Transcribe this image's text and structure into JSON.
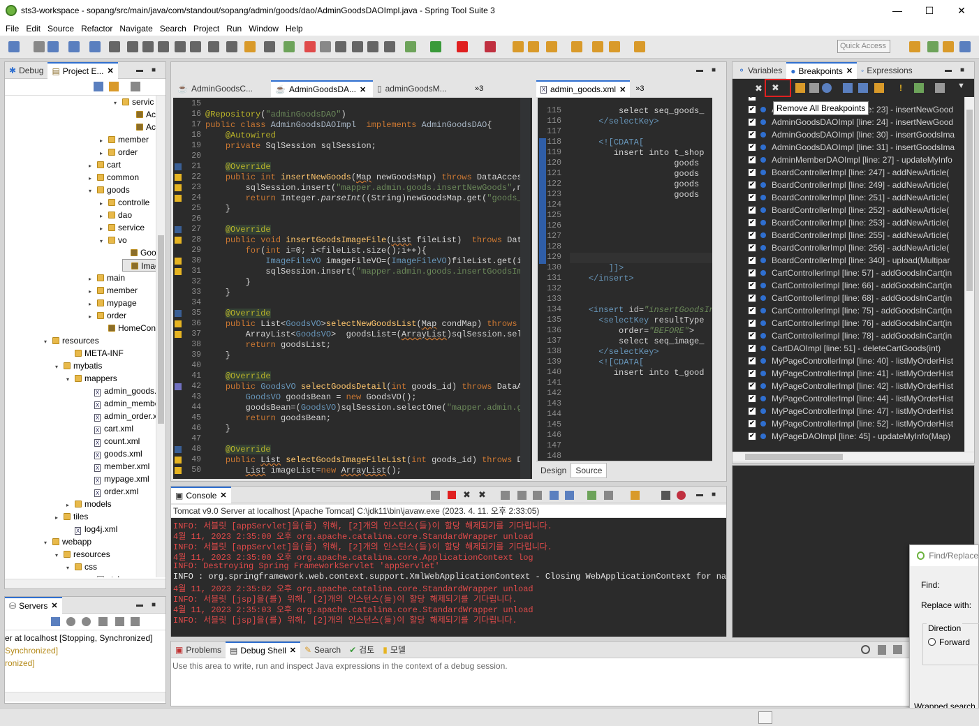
{
  "window": {
    "title": "sts3-workspace - sopang/src/main/java/com/standout/sopang/admin/goods/dao/AdminGoodsDAOImpl.java - Spring Tool Suite 3",
    "min": "—",
    "max": "☐",
    "close": "✕"
  },
  "menu": [
    "File",
    "Edit",
    "Source",
    "Refactor",
    "Navigate",
    "Search",
    "Project",
    "Run",
    "Window",
    "Help"
  ],
  "quick_access": "Quick Access",
  "left_panel": {
    "tabs": [
      {
        "label": "Debug"
      },
      {
        "label": "Project E..."
      }
    ],
    "tree": [
      {
        "indent": 164,
        "kind": "folder",
        "label": "servic",
        "twisty": "▾"
      },
      {
        "indent": 184,
        "kind": "java",
        "label": "Ac"
      },
      {
        "indent": 184,
        "kind": "java",
        "label": "Ac"
      },
      {
        "indent": 144,
        "kind": "folder",
        "label": "member",
        "twisty": "▸"
      },
      {
        "indent": 144,
        "kind": "folder",
        "label": "order",
        "twisty": "▸"
      },
      {
        "indent": 128,
        "kind": "folder",
        "label": "cart",
        "twisty": "▸"
      },
      {
        "indent": 128,
        "kind": "folder",
        "label": "common",
        "twisty": "▸"
      },
      {
        "indent": 128,
        "kind": "folder",
        "label": "goods",
        "twisty": "▾"
      },
      {
        "indent": 144,
        "kind": "folder",
        "label": "controlle",
        "twisty": "▸"
      },
      {
        "indent": 144,
        "kind": "folder",
        "label": "dao",
        "twisty": "▸"
      },
      {
        "indent": 144,
        "kind": "folder",
        "label": "service",
        "twisty": "▸"
      },
      {
        "indent": 144,
        "kind": "folder",
        "label": "vo",
        "twisty": "▾"
      },
      {
        "indent": 176,
        "kind": "java",
        "label": "Good"
      },
      {
        "indent": 176,
        "kind": "java",
        "label": "Image",
        "selected": true
      },
      {
        "indent": 128,
        "kind": "folder",
        "label": "main",
        "twisty": "▸"
      },
      {
        "indent": 128,
        "kind": "folder",
        "label": "member",
        "twisty": "▸"
      },
      {
        "indent": 128,
        "kind": "folder",
        "label": "mypage",
        "twisty": "▸"
      },
      {
        "indent": 128,
        "kind": "folder",
        "label": "order",
        "twisty": "▸"
      },
      {
        "indent": 144,
        "kind": "java",
        "label": "HomeCont"
      },
      {
        "indent": 64,
        "kind": "folder",
        "label": "resources",
        "twisty": "▾"
      },
      {
        "indent": 96,
        "kind": "folder",
        "label": "META-INF"
      },
      {
        "indent": 80,
        "kind": "folder",
        "label": "mybatis",
        "twisty": "▾"
      },
      {
        "indent": 96,
        "kind": "folder",
        "label": "mappers",
        "twisty": "▾"
      },
      {
        "indent": 124,
        "kind": "xml",
        "label": "admin_goods.x"
      },
      {
        "indent": 124,
        "kind": "xml",
        "label": "admin_membe"
      },
      {
        "indent": 124,
        "kind": "xml",
        "label": "admin_order.x"
      },
      {
        "indent": 124,
        "kind": "xml",
        "label": "cart.xml"
      },
      {
        "indent": 124,
        "kind": "xml",
        "label": "count.xml"
      },
      {
        "indent": 124,
        "kind": "xml",
        "label": "goods.xml"
      },
      {
        "indent": 124,
        "kind": "xml",
        "label": "member.xml"
      },
      {
        "indent": 124,
        "kind": "xml",
        "label": "mypage.xml"
      },
      {
        "indent": 124,
        "kind": "xml",
        "label": "order.xml"
      },
      {
        "indent": 96,
        "kind": "folder",
        "label": "models",
        "twisty": "▸"
      },
      {
        "indent": 80,
        "kind": "folder",
        "label": "tiles",
        "twisty": "▸"
      },
      {
        "indent": 96,
        "kind": "xml",
        "label": "log4j.xml"
      },
      {
        "indent": 64,
        "kind": "folder",
        "label": "webapp",
        "twisty": "▾"
      },
      {
        "indent": 80,
        "kind": "folder",
        "label": "resources",
        "twisty": "▾"
      },
      {
        "indent": 96,
        "kind": "folder",
        "label": "css",
        "twisty": "▾"
      },
      {
        "indent": 128,
        "kind": "file",
        "label": "style.css"
      }
    ]
  },
  "servers": {
    "tab": "Servers",
    "rows": [
      "er at localhost  [Stopping, Synchronized]",
      "Synchronized]",
      "ronized]"
    ]
  },
  "editor": {
    "tabs": [
      {
        "label": "AdminGoodsC..."
      },
      {
        "label": "AdminGoodsDA...",
        "active": true
      },
      {
        "label": "adminGoodsM..."
      }
    ],
    "overflow": "»3",
    "lines": [
      {
        "n": "15",
        "html": ""
      },
      {
        "n": "16",
        "html": "<span style='color:#bbb529'>@Repository</span>(<span style='color:#6a8759'>\"adminGoodsDAO\"</span>)"
      },
      {
        "n": "17",
        "html": "<span style='color:#cc7832'>public class</span> <span style='color:#a9b7c6'>AdminGoodsDAOImpl</span>  <span style='color:#cc7832'>implements</span> <span style='color:#a9b7c6'>AdminGoodsDAO</span>{"
      },
      {
        "n": "18",
        "html": "    <span style='color:#bbb529'>@Autowired</span>"
      },
      {
        "n": "19",
        "html": "    <span style='color:#cc7832'>private</span> SqlSession sqlSession;"
      },
      {
        "n": "20",
        "html": ""
      },
      {
        "n": "21",
        "html": "    <span style='color:#bbb529;background:#344134'>@Override</span>"
      },
      {
        "n": "22",
        "html": "    <span style='color:#cc7832'>public int</span> <span style='color:#ffc66d'>insertNewGoods</span>(<span style='text-decoration:underline wavy #cc7832'>Map</span> newGoodsMap) <span style='color:#cc7832'>throws</span> DataAccess"
      },
      {
        "n": "23",
        "html": "        sqlSession.insert(<span style='color:#6a8759'>\"mapper.admin.goods.insertNewGoods\"</span>,ne"
      },
      {
        "n": "24",
        "html": "        <span style='color:#cc7832'>return</span> Integer.<i>parseInt</i>((String)newGoodsMap.get(<span style='color:#6a8759'>\"goods_i</span>"
      },
      {
        "n": "25",
        "html": "    }"
      },
      {
        "n": "26",
        "html": ""
      },
      {
        "n": "27",
        "html": "    <span style='color:#bbb529;background:#344134'>@Override</span>"
      },
      {
        "n": "28",
        "html": "    <span style='color:#cc7832'>public void</span> <span style='color:#ffc66d'>insertGoodsImageFile</span>(<span style='text-decoration:underline wavy #cc7832'>List</span> fileList)  <span style='color:#cc7832'>throws</span> Data"
      },
      {
        "n": "29",
        "html": "        <span style='color:#cc7832'>for</span>(<span style='color:#cc7832'>int</span> i=0; i&lt;fileList.size();i++){"
      },
      {
        "n": "30",
        "html": "            <span style='color:#6897bb'>ImageFileVO</span> imageFileVO=(<span style='color:#6897bb'>ImageFileVO</span>)fileList.get(i)"
      },
      {
        "n": "31",
        "html": "            sqlSession.insert(<span style='color:#6a8759'>\"mapper.admin.goods.insertGoodsIma</span>"
      },
      {
        "n": "32",
        "html": "        }"
      },
      {
        "n": "33",
        "html": "    }"
      },
      {
        "n": "34",
        "html": ""
      },
      {
        "n": "35",
        "html": "    <span style='color:#bbb529;background:#344134'>@Override</span>"
      },
      {
        "n": "36",
        "html": "    <span style='color:#cc7832'>public</span> List&lt;<span style='color:#6897bb'>GoodsVO</span>&gt;<span style='color:#ffc66d'>selectNewGoodsList</span>(<span style='text-decoration:underline wavy #cc7832'>Map</span> condMap) <span style='color:#cc7832'>throws</span> D"
      },
      {
        "n": "37",
        "html": "        ArrayList&lt;<span style='color:#6897bb'>GoodsVO</span>&gt;  goodsList=(<span style='text-decoration:underline wavy #cc7832'>ArrayList</span>)sqlSession.sele"
      },
      {
        "n": "38",
        "html": "        <span style='color:#cc7832'>return</span> goodsList;"
      },
      {
        "n": "39",
        "html": "    }"
      },
      {
        "n": "40",
        "html": ""
      },
      {
        "n": "41",
        "html": "    <span style='color:#bbb529;background:#344134'>@Override</span>"
      },
      {
        "n": "42",
        "html": "    <span style='color:#cc7832'>public</span> <span style='color:#6897bb'>GoodsVO</span> <span style='color:#ffc66d'>selectGoodsDetail</span>(<span style='color:#cc7832'>int</span> goods_id) <span style='color:#cc7832'>throws</span> DataAc"
      },
      {
        "n": "43",
        "html": "        <span style='color:#6897bb'>GoodsVO</span> goodsBean = <span style='color:#cc7832'>new</span> GoodsVO();"
      },
      {
        "n": "44",
        "html": "        goodsBean=(<span style='color:#6897bb'>GoodsVO</span>)sqlSession.selectOne(<span style='color:#6a8759'>\"mapper.admin.go</span>"
      },
      {
        "n": "45",
        "html": "        <span style='color:#cc7832'>return</span> goodsBean;"
      },
      {
        "n": "46",
        "html": "    }"
      },
      {
        "n": "47",
        "html": ""
      },
      {
        "n": "48",
        "html": "    <span style='color:#bbb529;background:#344134'>@Override</span>"
      },
      {
        "n": "49",
        "html": "    <span style='color:#cc7832'>public</span> <span style='text-decoration:underline wavy #cc7832'>List</span> <span style='color:#ffc66d'>selectGoodsImageFileList</span>(<span style='color:#cc7832'>int</span> goods_id) <span style='color:#cc7832'>throws</span> Da"
      },
      {
        "n": "50",
        "html": "        <span style='text-decoration:underline wavy #cc7832'>List</span> imageList=<span style='color:#cc7832'>new</span> <span style='text-decoration:underline wavy #cc7832'>ArrayList</span>();"
      }
    ]
  },
  "xml_editor": {
    "tab": "admin_goods.xml",
    "overflow": "»3",
    "bottom_tabs": [
      "Design",
      "Source"
    ],
    "lines": [
      {
        "n": "115",
        "html": "          select seq_goods_"
      },
      {
        "n": "116",
        "html": "      <span style='color:#6897bb'>&lt;/selectKey&gt;</span>"
      },
      {
        "n": "117",
        "html": ""
      },
      {
        "n": "118",
        "html": "      <span style='color:#6897bb'>&lt;![CDATA[</span>"
      },
      {
        "n": "119",
        "html": "         insert into t_shop"
      },
      {
        "n": "120",
        "html": "                     goods"
      },
      {
        "n": "121",
        "html": "                     goods"
      },
      {
        "n": "122",
        "html": "                     goods"
      },
      {
        "n": "123",
        "html": "                     goods"
      },
      {
        "n": "124",
        "html": ""
      },
      {
        "n": "125",
        "html": ""
      },
      {
        "n": "126",
        "html": ""
      },
      {
        "n": "127",
        "html": ""
      },
      {
        "n": "128",
        "html": ""
      },
      {
        "n": "129",
        "html": ""
      },
      {
        "n": "130",
        "html": "        <span style='color:#6897bb'>]]&gt;</span>"
      },
      {
        "n": "131",
        "html": "    <span style='color:#6897bb'>&lt;/insert&gt;</span>"
      },
      {
        "n": "132",
        "html": ""
      },
      {
        "n": "133",
        "html": ""
      },
      {
        "n": "134",
        "html": "    <span style='color:#6897bb'>&lt;insert</span> <span style='color:#bababa'>id</span>=<span style='color:#6a8759'><i>\"insertGoodsIn</i></span>"
      },
      {
        "n": "135",
        "html": "      <span style='color:#6897bb'>&lt;selectKey</span> resultType"
      },
      {
        "n": "136",
        "html": "          order=<span style='color:#6a8759'><i>\"BEFORE\"</i></span>&gt;"
      },
      {
        "n": "137",
        "html": "          select seq_image_"
      },
      {
        "n": "138",
        "html": "      <span style='color:#6897bb'>&lt;/selectKey&gt;</span>"
      },
      {
        "n": "139",
        "html": "      <span style='color:#6897bb'>&lt;![CDATA[</span>"
      },
      {
        "n": "140",
        "html": "         insert into t_good"
      },
      {
        "n": "141",
        "html": ""
      },
      {
        "n": "142",
        "html": ""
      },
      {
        "n": "143",
        "html": ""
      },
      {
        "n": "144",
        "html": ""
      },
      {
        "n": "145",
        "html": ""
      },
      {
        "n": "146",
        "html": ""
      },
      {
        "n": "147",
        "html": ""
      },
      {
        "n": "148",
        "html": ""
      }
    ]
  },
  "breakpoints": {
    "tabs": [
      {
        "label": "Variables"
      },
      {
        "label": "Breakpoints",
        "active": true
      },
      {
        "label": "Expressions"
      }
    ],
    "tooltip": "Remove All Breakpoints",
    "rows": [
      "AdminGoodsDAOImpl [line: 23] - insertNewGood",
      "AdminGoodsDAOImpl [line: 24] - insertNewGood",
      "AdminGoodsDAOImpl [line: 30] - insertGoodsIma",
      "AdminGoodsDAOImpl [line: 31] - insertGoodsIma",
      "AdminMemberDAOImpl [line: 27] - updateMyInfo",
      "BoardControllerImpl [line: 247] - addNewArticle(",
      "BoardControllerImpl [line: 249] - addNewArticle(",
      "BoardControllerImpl [line: 251] - addNewArticle(",
      "BoardControllerImpl [line: 252] - addNewArticle(",
      "BoardControllerImpl [line: 253] - addNewArticle(",
      "BoardControllerImpl [line: 255] - addNewArticle(",
      "BoardControllerImpl [line: 256] - addNewArticle(",
      "BoardControllerImpl [line: 340] - upload(Multipar",
      "CartControllerImpl [line: 57] - addGoodsInCart(in",
      "CartControllerImpl [line: 66] - addGoodsInCart(in",
      "CartControllerImpl [line: 68] - addGoodsInCart(in",
      "CartControllerImpl [line: 75] - addGoodsInCart(in",
      "CartControllerImpl [line: 76] - addGoodsInCart(in",
      "CartControllerImpl [line: 78] - addGoodsInCart(in",
      "CartDAOImpl [line: 51] - deleteCartGoods(int)",
      "MyPageControllerImpl [line: 40] - listMyOrderHist",
      "MyPageControllerImpl [line: 41] - listMyOrderHist",
      "MyPageControllerImpl [line: 42] - listMyOrderHist",
      "MyPageControllerImpl [line: 44] - listMyOrderHist",
      "MyPageControllerImpl [line: 47] - listMyOrderHist",
      "MyPageControllerImpl [line: 52] - listMyOrderHist",
      "MyPageDAOImpl [line: 45] - updateMyInfo(Map)"
    ]
  },
  "console": {
    "tab": "Console",
    "header": "Tomcat v9.0 Server at localhost [Apache Tomcat] C:\\jdk11\\bin\\javaw.exe (2023. 4. 11. 오후 2:33:05)",
    "lines": [
      {
        "t": "INFO: 서블릿 [appServlet]을(를) 위해, [2]개의 인스턴스(들)이 할당 해제되기를 기다립니다.",
        "c": "#e04a4a"
      },
      {
        "t": "4월 11, 2023 2:35:00 오후 org.apache.catalina.core.StandardWrapper unload",
        "c": "#e04a4a"
      },
      {
        "t": "INFO: 서블릿 [appServlet]을(를) 위해, [2]개의 인스턴스(들)이 할당 해제되기를 기다립니다.",
        "c": "#e04a4a"
      },
      {
        "t": "4월 11, 2023 2:35:00 오후 org.apache.catalina.core.ApplicationContext log",
        "c": "#e04a4a"
      },
      {
        "t": "INFO: Destroying Spring FrameworkServlet 'appServlet'",
        "c": "#e04a4a"
      },
      {
        "t": "INFO : org.springframework.web.context.support.XmlWebApplicationContext - Closing WebApplicationContext for name:",
        "c": "#e6e6e6"
      },
      {
        "t": "4월 11, 2023 2:35:02 오후 org.apache.catalina.core.StandardWrapper unload",
        "c": "#e04a4a"
      },
      {
        "t": "INFO: 서블릿 [jsp]을(를) 위해, [2]개의 인스턴스(들)이 할당 해제되기를 기다립니다.",
        "c": "#e04a4a"
      },
      {
        "t": "4월 11, 2023 2:35:03 오후 org.apache.catalina.core.StandardWrapper unload",
        "c": "#e04a4a"
      },
      {
        "t": "INFO: 서블릿 [jsp]을(를) 위해, [2]개의 인스턴스(들)이 할당 해제되기를 기다립니다.",
        "c": "#e04a4a"
      }
    ]
  },
  "bottom": {
    "tabs": [
      {
        "label": "Problems"
      },
      {
        "label": "Debug Shell",
        "active": true
      },
      {
        "label": "Search"
      },
      {
        "label": "검토"
      },
      {
        "label": "모델"
      }
    ],
    "hint": "Use this area to write, run and inspect Java expressions in the context of a debug session."
  },
  "find_replace": {
    "title": "Find/Replace",
    "find": "Find:",
    "replace": "Replace with:",
    "direction": "Direction",
    "forward": "Forward",
    "wrapped": "Wrapped search"
  }
}
